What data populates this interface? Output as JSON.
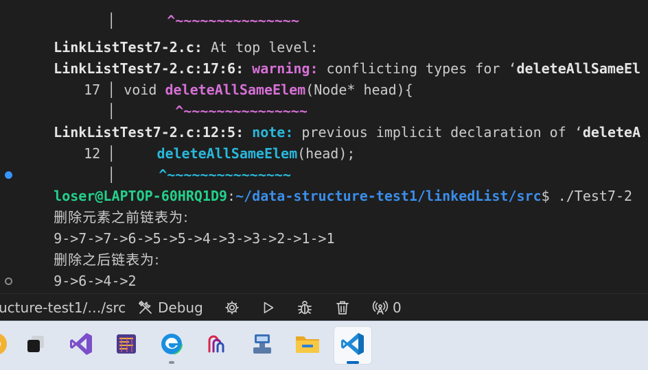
{
  "terminal": {
    "lines": {
      "l0_squiggle": "^~~~~~~~~~~~~~~~",
      "l1_file": "LinkListTest7-2.c:",
      "l1_msg": " At top level:",
      "l2_loc": "LinkListTest7-2.c:17:6:",
      "l2_kind": "warning:",
      "l2_msg": " conflicting types for ‘",
      "l2_name": "deleteAllSameEl",
      "l3_lineno": "17",
      "l3_pre": " void ",
      "l3_func": "deleteAllSameElem",
      "l3_post": "(Node* head){",
      "l4_squiggle": "^~~~~~~~~~~~~~~~",
      "l5_loc": "LinkListTest7-2.c:12:5:",
      "l5_kind": "note:",
      "l5_msg": " previous implicit declaration of ‘",
      "l5_name": "deleteA",
      "l6_lineno": "12",
      "l6_pre": "     ",
      "l6_func": "deleteAllSameElem",
      "l6_post": "(head);",
      "l7_squiggle": "^~~~~~~~~~~~~~~~",
      "prompt_user": "loser@LAPTOP-60HRQ1D9",
      "prompt_colon": ":",
      "prompt_path": "~/data-structure-test1/linkedList/src",
      "prompt_dollar": "$ ",
      "command": "./Test7-2",
      "out_before_label": "删除元素之前链表为:",
      "out_before_list": "9->7->7->6->5->5->4->3->3->2->1->1",
      "out_after_label": "删除之后链表为:",
      "out_after_list": "9->6->4->2"
    }
  },
  "statusbar": {
    "path": "ucture-test1/…/src",
    "debug_label": "Debug",
    "ports_count": "0"
  },
  "colors": {
    "terminal_bg": "#1e1e1e",
    "warning": "#d670d6",
    "note": "#29b8db",
    "prompt_user": "#23d18b",
    "prompt_path": "#3b8eea",
    "taskbar_bg": "#dfe6f0"
  },
  "taskbar": {
    "apps": [
      "chrome-icon",
      "task-view-icon",
      "visual-studio-icon",
      "device-manager-icon",
      "edge-icon",
      "ssh-client-icon",
      "network-icon",
      "file-explorer-icon",
      "vscode-icon"
    ]
  }
}
